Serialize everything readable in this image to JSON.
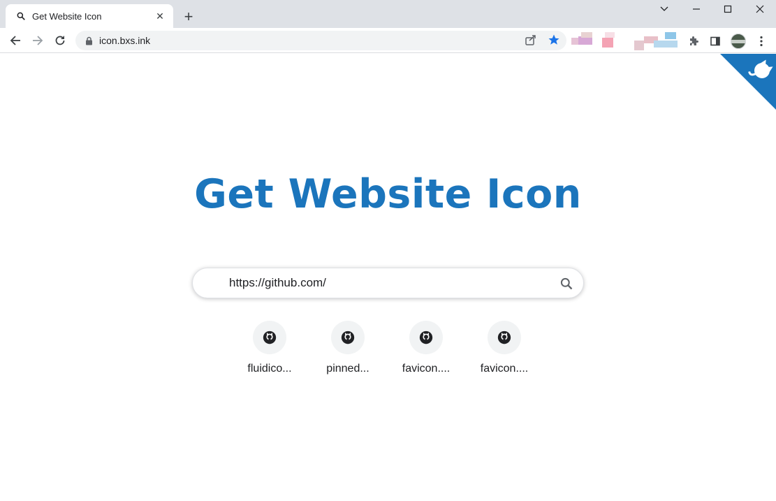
{
  "browser": {
    "tab_title": "Get Website Icon",
    "tab_close": "✕",
    "new_tab": "+",
    "url": "icon.bxs.ink"
  },
  "page": {
    "heading": "Get Website Icon",
    "search_value": "https://github.com/",
    "results": [
      {
        "label": "fluidico..."
      },
      {
        "label": "pinned..."
      },
      {
        "label": "favicon...."
      },
      {
        "label": "favicon...."
      }
    ]
  },
  "colors": {
    "accent": "#1b75bc",
    "star": "#1a73e8"
  }
}
